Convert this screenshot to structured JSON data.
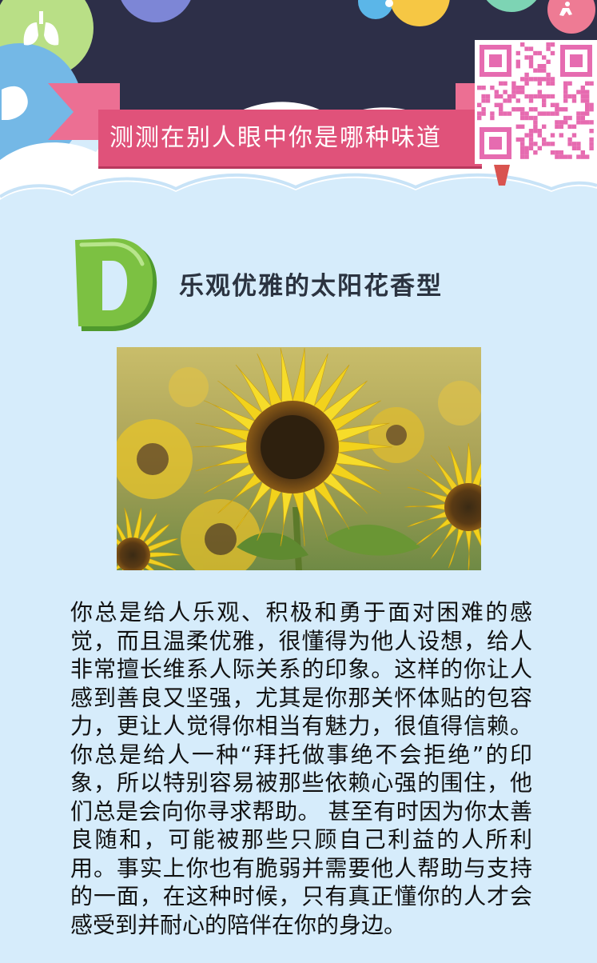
{
  "header": {
    "title": "测测在别人眼中你是哪种味道",
    "icons": [
      "lungs-icon",
      "muscle-arm-icon",
      "runner-icon",
      "qr-code-icon"
    ]
  },
  "result": {
    "grade": "D",
    "type_title": "乐观优雅的太阳花香型",
    "image_alt": "sunflower-photo",
    "description": "你总是给人乐观、积极和勇于面对困难的感觉，而且温柔优雅，很懂得为他人设想，给人非常擅长维系人际关系的印象。这样的你让人感到善良又坚强，尤其是你那关怀体贴的包容力，更让人觉得你相当有魅力，很值得信赖。你总是给人一种“拜托做事绝不会拒绝”的印象，所以特别容易被那些依赖心强的围住，他们总是会向你寻求帮助。 甚至有时因为你太善良随和，可能被那些只顾自己利益的人所利用。事实上你也有脆弱并需要他人帮助与支持的一面，在这种时候，只有真正懂你的人才会感受到并耐心的陪伴在你的身边。"
  },
  "colors": {
    "navy": "#2d2f48",
    "ribbon": "#e0527a",
    "background": "#d6ecfb",
    "badge_green": "#7cc142"
  }
}
